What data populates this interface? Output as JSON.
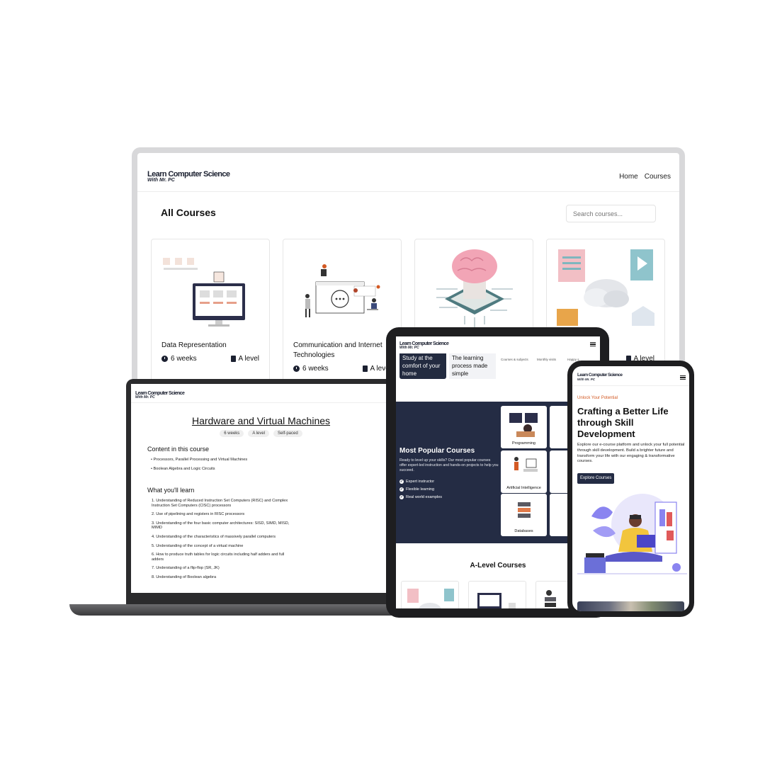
{
  "monitor": {
    "logo": {
      "main": "Learn Computer Science",
      "sub": "With Mr. PC"
    },
    "nav": [
      "Home",
      "Courses"
    ],
    "page_title": "All Courses",
    "search_placeholder": "Search courses...",
    "cards": [
      {
        "title": "Data Representation",
        "duration": "6 weeks",
        "level": "A level"
      },
      {
        "title": "Communication and Internet Technologies",
        "duration": "6 weeks",
        "level": "A level"
      },
      {
        "title": "",
        "duration": "",
        "level": ""
      },
      {
        "title": "",
        "duration": "",
        "level": "A level"
      }
    ]
  },
  "laptop": {
    "logo": {
      "main": "Learn Computer Science",
      "sub": "With Mr. PC"
    },
    "title": "Hardware and Virtual Machines",
    "tags": [
      "6 weeks",
      "A level",
      "Self-paced"
    ],
    "content_heading": "Content in this course",
    "content_items": [
      "Processors, Parallel Processing and Virtual Machines",
      "Boolean Algebra and Logic Circuits"
    ],
    "learn_heading": "What you'll learn",
    "learn_items": [
      "1. Understanding of Reduced Instruction Set Computers (RISC) and Complex Instruction Set Computers (CISC) processors",
      "2. Use of pipelining and registers in RISC processors",
      "3. Understanding of the four basic computer architectures: SISD, SIMD, MISD, MIMD",
      "4. Understanding of the characteristics of massively parallel computers",
      "5. Understanding of the concept of a virtual machine",
      "6. How to produce truth tables for logic circuits including half adders and full adders",
      "7. Understanding of a flip-flop (SR, JK)",
      "8. Understanding of Boolean algebra"
    ]
  },
  "tablet": {
    "logo": {
      "main": "Learn Computer Science",
      "sub": "With Mr. PC"
    },
    "hero_box1": "Study at the comfort of your home",
    "hero_box2": "The learning process made simple",
    "mini_stats": [
      "Courses & subjects",
      "Monthly visits",
      "Happy s"
    ],
    "popular_title": "Most Popular Courses",
    "popular_text": "Ready to level up your skills? Our most popular courses offer expert-led instruction and hands-on projects to help you succeed.",
    "checks": [
      "Expert instructor",
      "Flexible learning",
      "Real world examples"
    ],
    "tiles": [
      "Programming",
      "Alg",
      "Artificial Intelligence",
      "S",
      "Databases",
      "Digita"
    ],
    "alevel_title": "A-Level Courses"
  },
  "phone": {
    "logo": {
      "main": "Learn Computer Science",
      "sub": "With Mr. PC"
    },
    "kicker": "Unlock Your Potential",
    "title": "Crafting a Better Life through Skill Development",
    "text": "Explore our e-course platform and unlock your full potential through skill development. Build a brighter future and transform your life with our engaging & transformative courses.",
    "button": "Explore Courses"
  }
}
